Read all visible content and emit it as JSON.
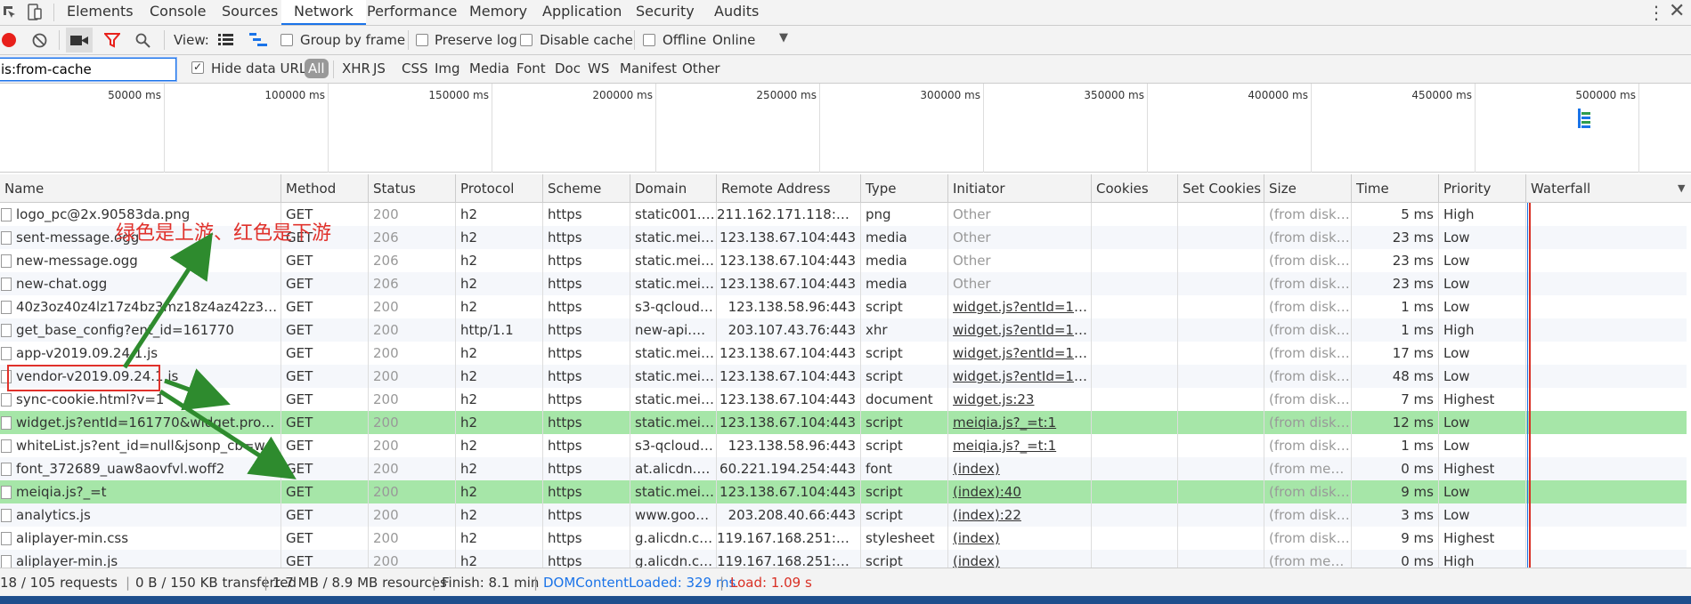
{
  "tabs": [
    "Elements",
    "Console",
    "Sources",
    "Network",
    "Performance",
    "Memory",
    "Application",
    "Security",
    "Audits"
  ],
  "active_tab": "Network",
  "toolbar": {
    "view_label": "View:",
    "group_by_frame": "Group by frame",
    "preserve_log": "Preserve log",
    "disable_cache": "Disable cache",
    "offline": "Offline",
    "throttle_value": "Online"
  },
  "filter": {
    "value": "is:from-cache",
    "hide_data_urls": "Hide data URLs",
    "types": [
      "All",
      "XHR",
      "JS",
      "CSS",
      "Img",
      "Media",
      "Font",
      "Doc",
      "WS",
      "Manifest",
      "Other"
    ]
  },
  "overview_ticks": [
    "50000 ms",
    "100000 ms",
    "150000 ms",
    "200000 ms",
    "250000 ms",
    "300000 ms",
    "350000 ms",
    "400000 ms",
    "450000 ms",
    "500000 ms"
  ],
  "columns": [
    "Name",
    "Method",
    "Status",
    "Protocol",
    "Scheme",
    "Domain",
    "Remote Address",
    "Type",
    "Initiator",
    "Cookies",
    "Set Cookies",
    "Size",
    "Time",
    "Priority",
    "Waterfall"
  ],
  "rows": [
    {
      "name": "logo_pc@2x.90583da.png",
      "method": "GET",
      "status": "200",
      "protocol": "h2",
      "scheme": "https",
      "domain": "static001.g...",
      "remote": "211.162.171.118:443",
      "type": "png",
      "initiator": "Other",
      "size": "(from disk ...",
      "time": "5 ms",
      "priority": "High"
    },
    {
      "name": "sent-message.ogg",
      "method": "GET",
      "status": "206",
      "protocol": "h2",
      "scheme": "https",
      "domain": "static.meiq...",
      "remote": "123.138.67.104:443",
      "type": "media",
      "initiator": "Other",
      "size": "(from disk ...",
      "time": "23 ms",
      "priority": "Low"
    },
    {
      "name": "new-message.ogg",
      "method": "GET",
      "status": "206",
      "protocol": "h2",
      "scheme": "https",
      "domain": "static.meiq...",
      "remote": "123.138.67.104:443",
      "type": "media",
      "initiator": "Other",
      "size": "(from disk ...",
      "time": "23 ms",
      "priority": "Low"
    },
    {
      "name": "new-chat.ogg",
      "method": "GET",
      "status": "206",
      "protocol": "h2",
      "scheme": "https",
      "domain": "static.meiq...",
      "remote": "123.138.67.104:443",
      "type": "media",
      "initiator": "Other",
      "size": "(from disk ...",
      "time": "23 ms",
      "priority": "Low"
    },
    {
      "name": "40z3oz40z4lz17z4bz3mz18z4az42z3mz40...",
      "method": "GET",
      "status": "200",
      "protocol": "h2",
      "scheme": "https",
      "domain": "s3-qcloud....",
      "remote": "123.138.58.96:443",
      "type": "script",
      "initiator": "widget.js?entId=161...",
      "size": "(from disk ...",
      "time": "1 ms",
      "priority": "Low"
    },
    {
      "name": "get_base_config?ent_id=161770",
      "method": "GET",
      "status": "200",
      "protocol": "http/1.1",
      "scheme": "https",
      "domain": "new-api.m...",
      "remote": "203.107.43.76:443",
      "type": "xhr",
      "initiator": "widget.js?entId=161...",
      "size": "(from disk ...",
      "time": "1 ms",
      "priority": "High"
    },
    {
      "name": "app-v2019.09.24.1.js",
      "method": "GET",
      "status": "200",
      "protocol": "h2",
      "scheme": "https",
      "domain": "static.meiq...",
      "remote": "123.138.67.104:443",
      "type": "script",
      "initiator": "widget.js?entId=161...",
      "size": "(from disk ...",
      "time": "17 ms",
      "priority": "Low"
    },
    {
      "name": "vendor-v2019.09.24.1.js",
      "method": "GET",
      "status": "200",
      "protocol": "h2",
      "scheme": "https",
      "domain": "static.meiq...",
      "remote": "123.138.67.104:443",
      "type": "script",
      "initiator": "widget.js?entId=161...",
      "size": "(from disk ...",
      "time": "48 ms",
      "priority": "Low"
    },
    {
      "name": "sync-cookie.html?v=1",
      "method": "GET",
      "status": "200",
      "protocol": "h2",
      "scheme": "https",
      "domain": "static.meiq...",
      "remote": "123.138.67.104:443",
      "type": "document",
      "initiator": "widget.js:23",
      "size": "(from disk ...",
      "time": "7 ms",
      "priority": "Highest"
    },
    {
      "name": "widget.js?entId=161770&widget.pro=1",
      "method": "GET",
      "status": "200",
      "protocol": "h2",
      "scheme": "https",
      "domain": "static.meiq...",
      "remote": "123.138.67.104:443",
      "type": "script",
      "initiator": "meiqia.js?_=t:1",
      "size": "(from disk ...",
      "time": "12 ms",
      "priority": "Low"
    },
    {
      "name": "whiteList.js?ent_id=null&jsonp_cb=whiteL...",
      "method": "GET",
      "status": "200",
      "protocol": "h2",
      "scheme": "https",
      "domain": "s3-qcloud....",
      "remote": "123.138.58.96:443",
      "type": "script",
      "initiator": "meiqia.js?_=t:1",
      "size": "(from disk ...",
      "time": "1 ms",
      "priority": "Low"
    },
    {
      "name": "font_372689_uaw8aovfvl.woff2",
      "method": "GET",
      "status": "200",
      "protocol": "h2",
      "scheme": "https",
      "domain": "at.alicdn.co...",
      "remote": "60.221.194.254:443",
      "type": "font",
      "initiator": "(index)",
      "size": "(from mem...",
      "time": "0 ms",
      "priority": "Highest"
    },
    {
      "name": "meiqia.js?_=t",
      "method": "GET",
      "status": "200",
      "protocol": "h2",
      "scheme": "https",
      "domain": "static.meiq...",
      "remote": "123.138.67.104:443",
      "type": "script",
      "initiator": "(index):40",
      "size": "(from disk ...",
      "time": "9 ms",
      "priority": "Low"
    },
    {
      "name": "analytics.js",
      "method": "GET",
      "status": "200",
      "protocol": "h2",
      "scheme": "https",
      "domain": "www.googl...",
      "remote": "203.208.40.66:443",
      "type": "script",
      "initiator": "(index):22",
      "size": "(from disk ...",
      "time": "3 ms",
      "priority": "Low"
    },
    {
      "name": "aliplayer-min.css",
      "method": "GET",
      "status": "200",
      "protocol": "h2",
      "scheme": "https",
      "domain": "g.alicdn.com",
      "remote": "119.167.168.251:443",
      "type": "stylesheet",
      "initiator": "(index)",
      "size": "(from disk ...",
      "time": "9 ms",
      "priority": "Highest"
    },
    {
      "name": "aliplayer-min.js",
      "method": "GET",
      "status": "200",
      "protocol": "h2",
      "scheme": "https",
      "domain": "g.alicdn.com",
      "remote": "119.167.168.251:443",
      "type": "script",
      "initiator": "(index)",
      "size": "(from mem...",
      "time": "0 ms",
      "priority": "High"
    }
  ],
  "status": {
    "requests": "18 / 105 requests",
    "transferred": "0 B / 150 KB transferred",
    "resources": "1.7 MB / 8.9 MB resources",
    "finish": "Finish: 8.1 min",
    "dcl": "DOMContentLoaded: 329 ms",
    "load": "Load: 1.09 s"
  },
  "annotation": "绿色是上游、红色是下游",
  "colors": {
    "accent": "#1a73e8",
    "highlight_row": "#a6e6a8",
    "annotation_red": "#e0312b",
    "arrow_green": "#2e8b2e",
    "dcl_blue": "#1a73e8",
    "load_red": "#d93025"
  }
}
